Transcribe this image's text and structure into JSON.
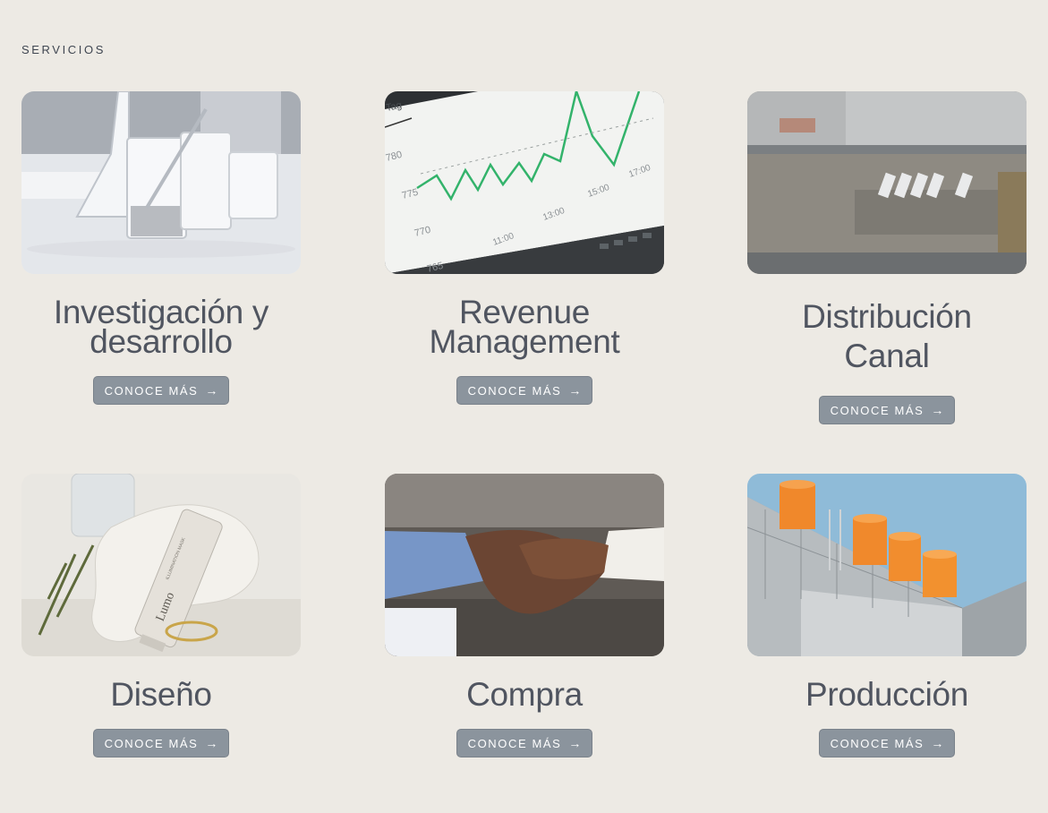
{
  "section": {
    "label": "SERVICIOS"
  },
  "cards": [
    {
      "title": "Investigación y desarrollo",
      "button": "CONOCE MÁS",
      "image": "laboratory-glassware-photo"
    },
    {
      "title": "Revenue Management",
      "button": "CONOCE MÁS",
      "image": "stock-chart-laptop-photo"
    },
    {
      "title": "Distribución Canal",
      "button": "CONOCE MÁS",
      "image": "warehouse-aerial-photo"
    },
    {
      "title": "Diseño",
      "button": "CONOCE MÁS",
      "image": "cosmetic-tube-photo"
    },
    {
      "title": "Compra",
      "button": "CONOCE MÁS",
      "image": "handshake-photo"
    },
    {
      "title": "Producción",
      "button": "CONOCE MÁS",
      "image": "factory-tanks-photo"
    }
  ],
  "chart_photo": {
    "tick_labels": [
      "780",
      "775",
      "770",
      "765",
      "11:00",
      "13:00",
      "15:00",
      "17:00",
      "Tag"
    ]
  },
  "product_photo": {
    "tube_text": "Lumo",
    "tube_subtext": "ILLUMINATION MASK"
  },
  "icons": {
    "button_arrow": "arrow-right-icon"
  },
  "colors": {
    "background": "#edeae4",
    "button": "#8b949d",
    "title": "#505560"
  }
}
